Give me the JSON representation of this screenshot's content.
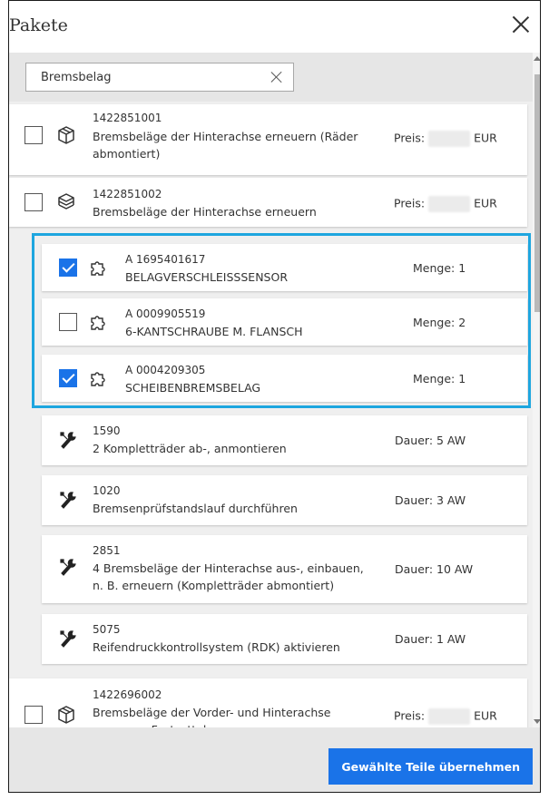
{
  "dialog": {
    "title": "Pakete"
  },
  "search": {
    "value": "Bremsbelag"
  },
  "packages": [
    {
      "number": "1422851001",
      "description": "Bremsbeläge der Hinterachse erneuern (Räder abmontiert)",
      "price_label": "Preis:",
      "currency": "EUR",
      "checked": false,
      "icon": "box-icon"
    },
    {
      "number": "1422851002",
      "description": "Bremsbeläge der Hinterachse erneuern",
      "price_label": "Preis:",
      "currency": "EUR",
      "checked": false,
      "icon": "box-stack-icon"
    }
  ],
  "parts": [
    {
      "number": "A 1695401617",
      "name": "BELAGVERSCHLEISSSENSOR",
      "quantity": "Menge: 1",
      "checked": true
    },
    {
      "number": "A 0009905519",
      "name": "6-KANTSCHRAUBE M. FLANSCH",
      "quantity": "Menge: 2",
      "checked": false
    },
    {
      "number": "A 0004209305",
      "name": "SCHEIBENBREMSBELAG",
      "quantity": "Menge: 1",
      "checked": true
    }
  ],
  "labor": [
    {
      "number": "1590",
      "description": "2 Kompletträder ab-, anmontieren",
      "duration": "Dauer: 5 AW"
    },
    {
      "number": "1020",
      "description": "Bremsenprüfstandslauf durchführen",
      "duration": "Dauer: 3 AW"
    },
    {
      "number": "2851",
      "description": "4 Bremsbeläge der Hinterachse aus-, einbauen, n. B. erneuern (Kompletträder abmontiert)",
      "duration": "Dauer: 10 AW"
    },
    {
      "number": "5075",
      "description": "Reifendruckkontrollsystem (RDK) aktivieren",
      "duration": "Dauer: 1 AW"
    }
  ],
  "package3": {
    "number": "1422696002",
    "description": "Bremsbeläge der Vorder- und Hinterachse erneuern, Festsattel",
    "price_label": "Preis:",
    "currency": "EUR",
    "checked": false
  },
  "footer": {
    "apply_label": "Gewählte Teile übernehmen"
  },
  "colors": {
    "accent": "#1a73e8",
    "highlight": "#1ea6df"
  }
}
